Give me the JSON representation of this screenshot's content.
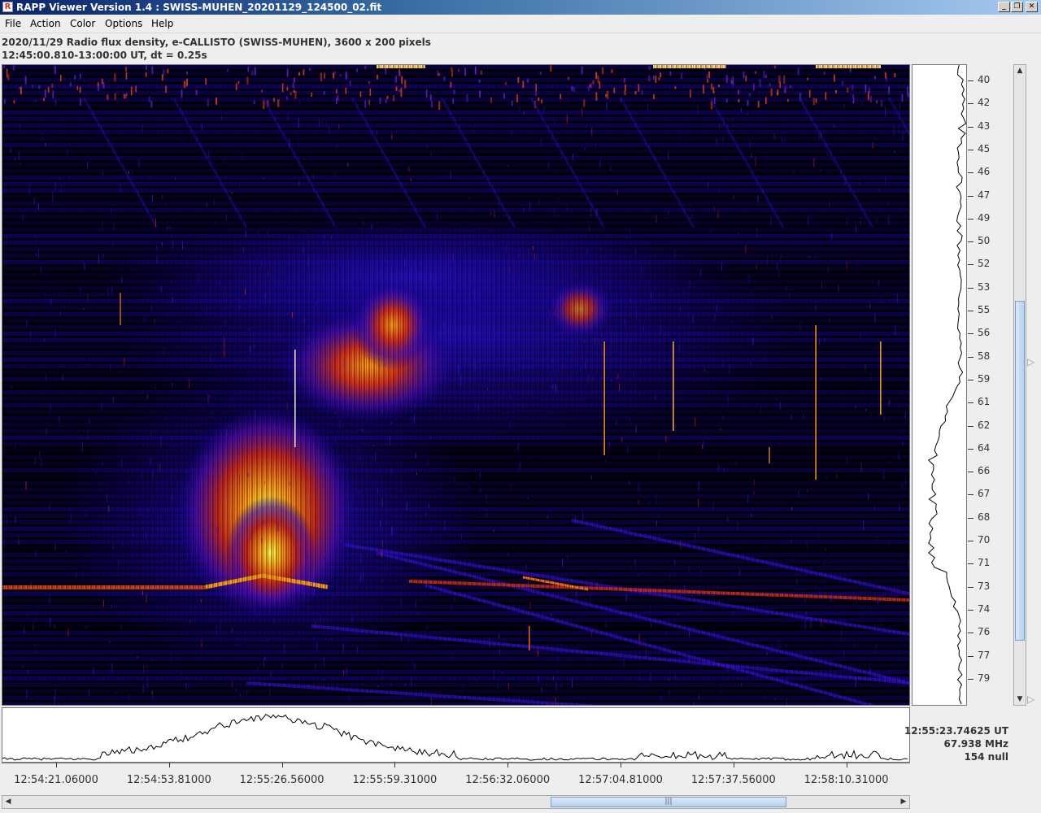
{
  "window": {
    "title": "RAPP Viewer Version 1.4 : SWISS-MUHEN_20201129_124500_02.fit",
    "controls": [
      "minimize",
      "restore",
      "close"
    ]
  },
  "menu": [
    "File",
    "Action",
    "Color",
    "Options",
    "Help"
  ],
  "info": {
    "line1": "2020/11/29  Radio flux density, e-CALLISTO (SWISS-MUHEN),  3600 x 200 pixels",
    "line2": "12:45:00.810-13:00:00 UT,  dt = 0.25s"
  },
  "frequency_axis": {
    "unit": "MHz",
    "labels": [
      "40",
      "42",
      "43",
      "45",
      "46",
      "47",
      "49",
      "50",
      "52",
      "53",
      "55",
      "56",
      "58",
      "59",
      "61",
      "62",
      "64",
      "66",
      "67",
      "68",
      "70",
      "71",
      "73",
      "74",
      "76",
      "77",
      "79"
    ]
  },
  "time_axis": {
    "labels": [
      "12:54:21.06000",
      "12:54:53.81000",
      "12:55:26.56000",
      "12:55:59.31000",
      "12:56:32.06000",
      "12:57:04.81000",
      "12:57:37.56000",
      "12:58:10.31000"
    ]
  },
  "cursor_readout": {
    "time": "12:55:23.74625 UT",
    "frequency": "67.938 MHz",
    "value": "154 null"
  },
  "colors": {
    "spectrogram_background": "#000000",
    "low": "#1a00b4",
    "mid": "#c8281e",
    "high": "#ff9c14",
    "peak": "#ffff50",
    "window_bg": "#eeeeee",
    "scroll_accent": "#7a9cc6"
  },
  "icons": {
    "app": "rapp-app-icon",
    "scroll_up": "arrow-up-icon",
    "scroll_down": "arrow-down-icon",
    "scroll_left": "arrow-left-icon",
    "scroll_right": "arrow-right-icon"
  }
}
